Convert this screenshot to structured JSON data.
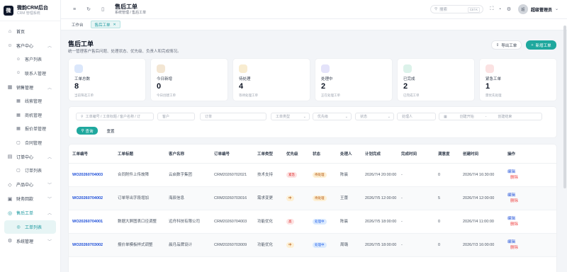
{
  "brand": {
    "logo": "微",
    "title": "微韵CRM后台",
    "subtitle": "CRM 管理系统"
  },
  "sidebar": {
    "items": [
      {
        "kind": "item",
        "icon": "home-icon",
        "glyph": "⌂",
        "label": "首页"
      },
      {
        "kind": "group",
        "icon": "users-icon",
        "glyph": "☺",
        "label": "客户中心",
        "open": true
      },
      {
        "kind": "sub",
        "icon": "user-icon",
        "glyph": "☺",
        "label": "客户列表"
      },
      {
        "kind": "sub",
        "icon": "contact-icon",
        "glyph": "☺",
        "label": "联系人管理"
      },
      {
        "kind": "group",
        "icon": "sales-icon",
        "glyph": "▦",
        "label": "销售管理",
        "open": true
      },
      {
        "kind": "sub",
        "icon": "grid-icon",
        "glyph": "▦",
        "label": "线索管理"
      },
      {
        "kind": "sub",
        "icon": "grid-icon",
        "glyph": "▦",
        "label": "商机管理"
      },
      {
        "kind": "sub",
        "icon": "grid-icon",
        "glyph": "▦",
        "label": "报价单管理"
      },
      {
        "kind": "sub",
        "icon": "document-icon",
        "glyph": "▢",
        "label": "合同管理"
      },
      {
        "kind": "group",
        "icon": "order-icon",
        "glyph": "▤",
        "label": "订单中心",
        "open": true
      },
      {
        "kind": "sub",
        "icon": "document-icon",
        "glyph": "▢",
        "label": "订单列表"
      },
      {
        "kind": "group",
        "icon": "product-icon",
        "glyph": "◇",
        "label": "产品中心",
        "open": false
      },
      {
        "kind": "group",
        "icon": "finance-icon",
        "glyph": "▣",
        "label": "财务回款",
        "open": false
      },
      {
        "kind": "group",
        "icon": "aftersale-icon",
        "glyph": "◎",
        "label": "售后工单",
        "open": true
      },
      {
        "kind": "sub",
        "icon": "ticket-icon",
        "glyph": "◎",
        "label": "工单列表",
        "active": true
      },
      {
        "kind": "group",
        "icon": "gear-icon",
        "glyph": "⚙",
        "label": "系统管理",
        "open": false
      }
    ]
  },
  "header": {
    "title": "售后工单",
    "breadcrumb": "系统管理 / 售后工单",
    "search_placeholder": "搜索",
    "search_shortcut": "Ctrl K",
    "avatar": "超",
    "user_name": "超级管理员"
  },
  "tabs": [
    {
      "label": "工作台",
      "active": false
    },
    {
      "label": "售后工单",
      "active": true
    }
  ],
  "page": {
    "title": "售后工单",
    "description": "统一管理客户售后问题、处理状态、优先级、负责人和完成情况。",
    "export_label": "导出工单",
    "new_label": "新增工单"
  },
  "stats": [
    {
      "label": "工单总数",
      "value": "8",
      "hint": "当前筛选工单",
      "color": "#dbe7fb"
    },
    {
      "label": "今日新增",
      "value": "0",
      "hint": "今日创建工单",
      "color": "#f3e6d3"
    },
    {
      "label": "待处理",
      "value": "4",
      "hint": "等待处理工单",
      "color": "#f8ecd0"
    },
    {
      "label": "处理中",
      "value": "2",
      "hint": "正在处理工单",
      "color": "#e4e3fa"
    },
    {
      "label": "已完成",
      "value": "2",
      "hint": "已完成工单",
      "color": "#dcf2ea"
    },
    {
      "label": "紧急工单",
      "value": "1",
      "hint": "需优先处理",
      "color": "#fbe2e2"
    }
  ],
  "filters": {
    "keyword": "工单编号 / 工单标题 / 客户名称 / 订",
    "customer": "客户",
    "order": "订单",
    "type": "工单类型",
    "priority": "优先级",
    "status": "状态",
    "owner": "处理人",
    "date_start": "创建开始",
    "date_sep": "-",
    "date_end": "创建结束",
    "query_label": "查询",
    "reset_label": "重置"
  },
  "table": {
    "columns": [
      "工单编号",
      "工单标题",
      "客户名称",
      "订单编号",
      "工单类型",
      "优先级",
      "状态",
      "处理人",
      "计划完成",
      "完成时间",
      "满意度",
      "创建时间",
      "操作"
    ],
    "edit_label": "编辑",
    "delete_label": "删除",
    "rows": [
      {
        "no": "WO20260704003",
        "title": "合同附件上传故障",
        "customer": "云启数字集团",
        "order": "CRM20260702021",
        "type": "技术支持",
        "priority": "紧急",
        "pcolor": "#fde2e2",
        "ptext": "#dc2626",
        "status": "待处理",
        "scolor": "#fdf0d5",
        "stext": "#b45309",
        "owner": "陈晨",
        "plan": "2026/7/4 20:00:00",
        "done": "-",
        "sat": "0",
        "created": "2026/7/4 16:30:00"
      },
      {
        "no": "WO20260704002",
        "title": "订单导出字段增加",
        "customer": "海辰信息",
        "order": "CRM20260703016",
        "type": "需求变更",
        "priority": "中",
        "pcolor": "#fdf0d5",
        "ptext": "#b45309",
        "status": "待处理",
        "scolor": "#fdf0d5",
        "stext": "#b45309",
        "owner": "王蕾",
        "plan": "2026/7/5 12:00:00",
        "done": "-",
        "sat": "5",
        "created": "2026/7/4 12:00:00"
      },
      {
        "no": "WO20260704001",
        "title": "数据大屏图表口径调整",
        "customer": "远舟科技有限公司",
        "order": "CRM20260704003",
        "type": "功能优化",
        "priority": "高",
        "pcolor": "#fde2e2",
        "ptext": "#dc2626",
        "status": "处理中",
        "scolor": "#dbeafe",
        "stext": "#2563eb",
        "owner": "陈晨",
        "plan": "2026/7/5 18:00:00",
        "done": "-",
        "sat": "0",
        "created": "2026/7/4 11:00:00"
      },
      {
        "no": "WO20260703002",
        "title": "报价单模板样式调整",
        "customer": "晨月品牌设计",
        "order": "CRM20260703009",
        "type": "功能优化",
        "priority": "中",
        "pcolor": "#fdf0d5",
        "ptext": "#b45309",
        "status": "处理中",
        "scolor": "#dbeafe",
        "stext": "#2563eb",
        "owner": "周璐",
        "plan": "2026/7/5 18:00:00",
        "done": "-",
        "sat": "0",
        "created": "2026/7/3 16:00:00"
      }
    ]
  }
}
